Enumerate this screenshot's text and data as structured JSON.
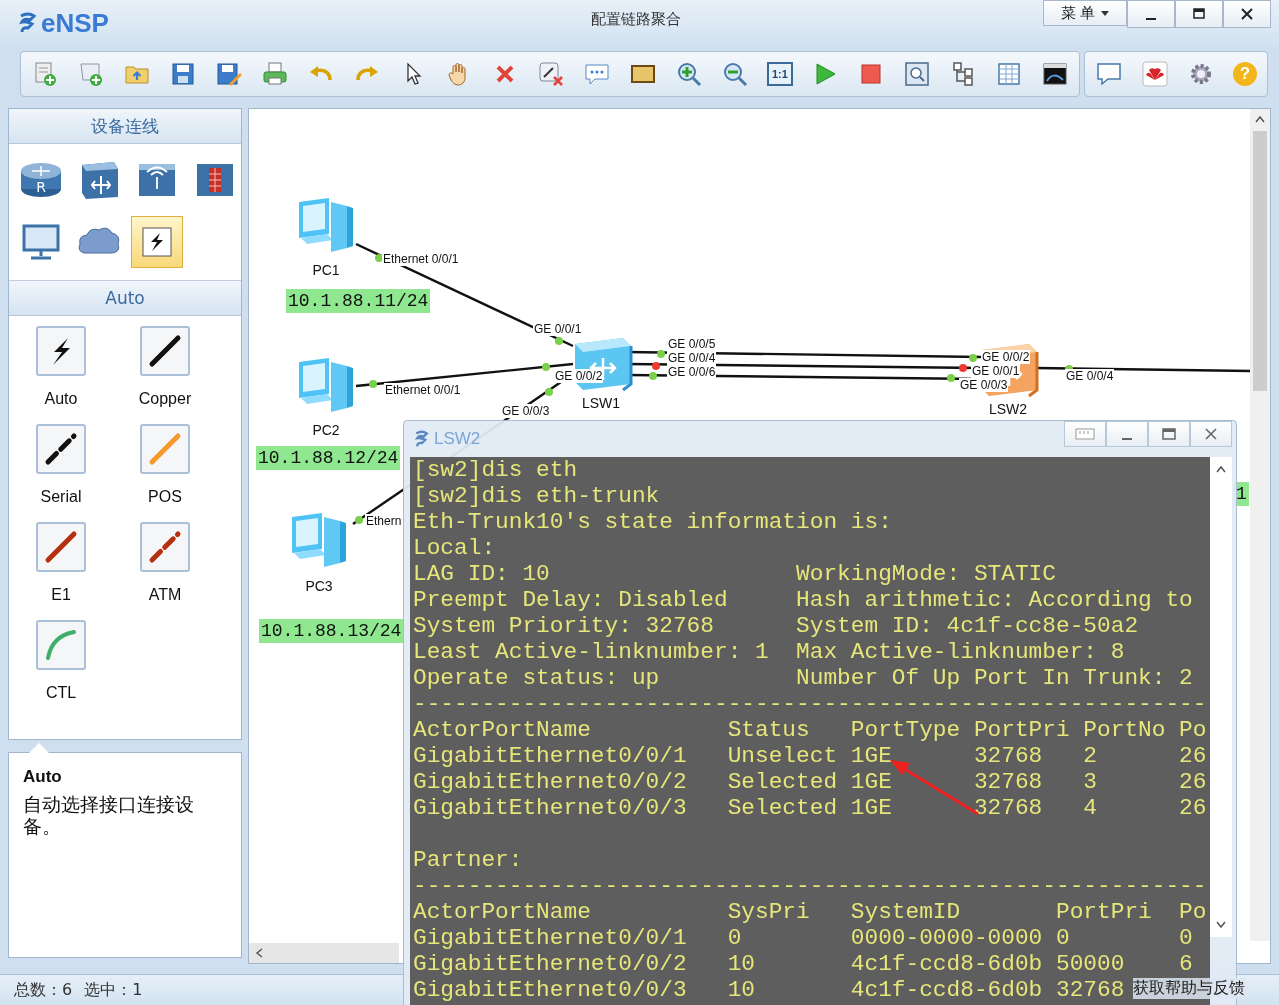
{
  "window": {
    "logo": "eNSP",
    "title": "配置链路聚合",
    "menu": "菜 单"
  },
  "toolbar": {
    "zoom_reset": "1:1",
    "help": "?"
  },
  "device_panel": {
    "title": "设备连线",
    "devices": [
      {
        "kind": "router",
        "glyph": "R",
        "selected": false
      },
      {
        "kind": "switch",
        "selected": false
      },
      {
        "kind": "wireless",
        "selected": false
      },
      {
        "kind": "firewall",
        "selected": false
      },
      {
        "kind": "pc",
        "selected": false
      },
      {
        "kind": "cloud",
        "selected": false
      },
      {
        "kind": "cable",
        "selected": true
      }
    ]
  },
  "cable_panel": {
    "title": "Auto",
    "cables": [
      {
        "kind": "auto",
        "label": "Auto"
      },
      {
        "kind": "copper",
        "label": "Copper"
      },
      {
        "kind": "serial",
        "label": "Serial"
      },
      {
        "kind": "pos",
        "label": "POS"
      },
      {
        "kind": "e1",
        "label": "E1"
      },
      {
        "kind": "atm",
        "label": "ATM"
      },
      {
        "kind": "ctl",
        "label": "CTL"
      }
    ]
  },
  "info": {
    "title": "Auto",
    "description": "自动选择接口连接设备。"
  },
  "canvas": {
    "nodes": [
      {
        "kind": "pc",
        "label": "PC1",
        "ip": "10.1.88.11/24",
        "selected": false
      },
      {
        "kind": "pc",
        "label": "PC2",
        "ip": "10.1.88.12/24",
        "selected": false
      },
      {
        "kind": "pc",
        "label": "PC3",
        "ip": "10.1.88.13/24",
        "selected": false
      },
      {
        "kind": "switch",
        "label": "LSW1",
        "selected": false
      },
      {
        "kind": "switch",
        "label": "LSW2",
        "selected": true
      }
    ],
    "ports": [
      {
        "label": "Ethernet 0/0/1",
        "up": true
      },
      {
        "label": "GE 0/0/1",
        "up": true
      },
      {
        "label": "Ethernet 0/0/1",
        "up": true
      },
      {
        "label": "GE 0/0/2",
        "up": true
      },
      {
        "label": "GE 0/0/3",
        "up": true
      },
      {
        "label": "Ethern",
        "up": true
      },
      {
        "label": "GE 0/0/5",
        "up": true
      },
      {
        "label": "GE 0/0/4",
        "up": false
      },
      {
        "label": "GE 0/0/6",
        "up": true
      },
      {
        "label": "GE 0/0/2",
        "up": true
      },
      {
        "label": "GE 0/0/1",
        "up": false
      },
      {
        "label": "GE 0/0/3",
        "up": true
      },
      {
        "label": "GE 0/0/4",
        "up": true
      }
    ],
    "edge_label": "1"
  },
  "console": {
    "title": "LSW2",
    "lines": [
      {
        "text": "[sw2]dis eth"
      },
      {
        "text": "[sw2]dis eth-trunk"
      },
      {
        "text": "Eth-Trunk10's state information is:"
      },
      {
        "text": "Local:"
      },
      {
        "text": "LAG ID: 10                  WorkingMode: STATIC"
      },
      {
        "text": "Preempt Delay: Disabled     Hash arithmetic: According to"
      },
      {
        "text": "System Priority: 32768      System ID: 4c1f-cc8e-50a2"
      },
      {
        "text": "Least Active-linknumber: 1  Max Active-linknumber: 8"
      },
      {
        "text": "Operate status: up          Number Of Up Port In Trunk: 2"
      },
      {
        "text": "----------------------------------------------------------"
      },
      {
        "text": "ActorPortName          Status   PortType PortPri PortNo Po"
      },
      {
        "text": "GigabitEthernet0/0/1   Unselect 1GE      32768   2      26"
      },
      {
        "text": "GigabitEthernet0/0/2   Selected 1GE      32768   3      26"
      },
      {
        "text": "GigabitEthernet0/0/3   Selected 1GE      32768   4      26"
      },
      {
        "text": "Partner:",
        "space_before": true
      },
      {
        "text": "----------------------------------------------------------"
      },
      {
        "text": "ActorPortName          SysPri   SystemID       PortPri  Po"
      },
      {
        "text": "GigabitEthernet0/0/1   0        0000-0000-0000 0        0"
      },
      {
        "text": "GigabitEthernet0/0/2   10       4c1f-ccd8-6d0b 50000    6"
      },
      {
        "text": "GigabitEthernet0/0/3   10       4c1f-ccd8-6d0b 32768"
      }
    ]
  },
  "status_bar": {
    "total": "总数：6",
    "selected": "选中：1",
    "help_link": "获取帮助与反馈"
  }
}
